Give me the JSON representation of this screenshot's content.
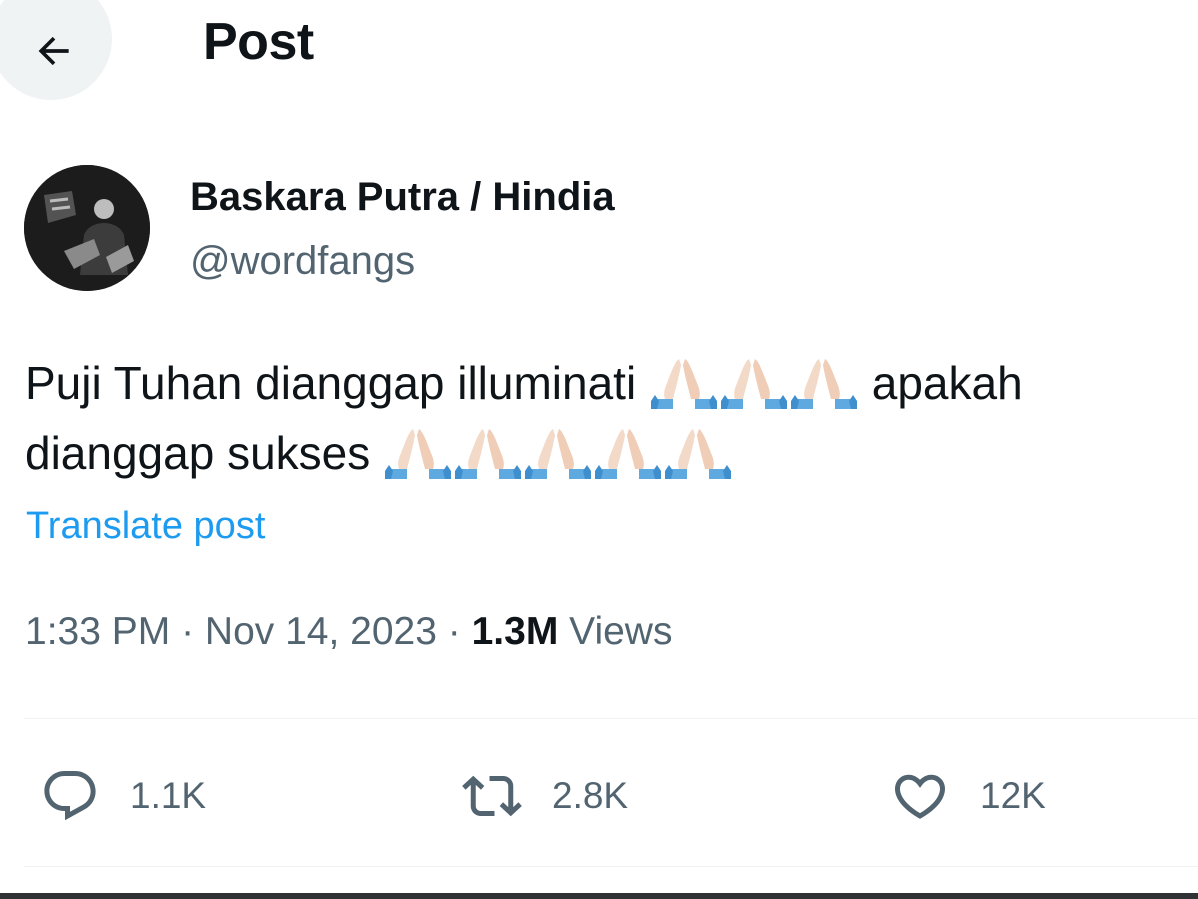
{
  "header": {
    "title": "Post",
    "back_icon": "arrow-left-icon"
  },
  "author": {
    "display_name": "Baskara Putra / Hindia",
    "handle": "@wordfangs"
  },
  "post": {
    "text_part1": "Puji Tuhan dianggap illuminati ",
    "text_part2": " apakah dianggap sukses ",
    "emoji_icon": "folded-hands-icon",
    "translate_label": "Translate post",
    "time": "1:33 PM",
    "date": "Nov 14, 2023",
    "separator": " · ",
    "views_count": "1.3M",
    "views_label": " Views"
  },
  "actions": {
    "replies": "1.1K",
    "reposts": "2.8K",
    "likes": "12K"
  },
  "colors": {
    "accent": "#1d9bf0",
    "secondary_text": "#536471",
    "primary_text": "#0f1419"
  }
}
